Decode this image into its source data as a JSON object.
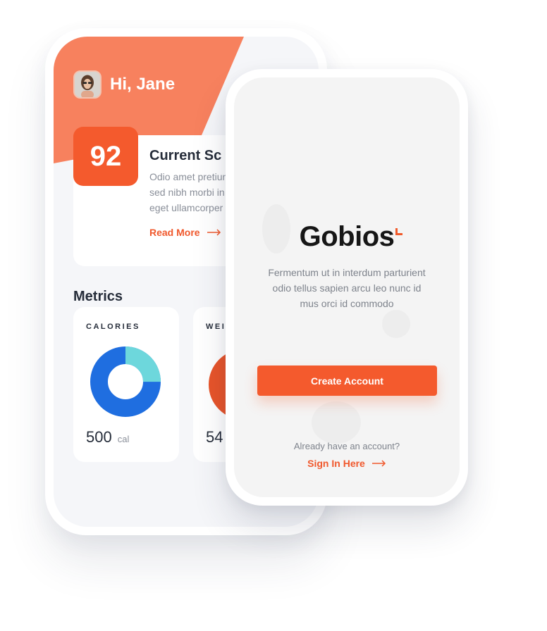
{
  "back_screen": {
    "greeting": "Hi, Jane",
    "score": {
      "value": "92",
      "title": "Current Sc",
      "description_lines": [
        "Odio amet pretiun",
        "sed nibh morbi in",
        "eget ullamcorper"
      ],
      "read_more": "Read More"
    },
    "metrics": {
      "title": "Metrics",
      "cards": [
        {
          "label": "CALORIES",
          "value": "500",
          "unit": "cal",
          "donut": {
            "blue_fraction": 0.75,
            "teal_fraction": 0.25
          }
        },
        {
          "label": "WEI",
          "value": "54"
        }
      ]
    }
  },
  "front_screen": {
    "logo": "Gobios",
    "description_lines": [
      "Fermentum ut in interdum parturient",
      "odio tellus sapien arcu leo nunc id",
      "mus orci id commodo"
    ],
    "create_account": "Create Account",
    "already_text": "Already have an account?",
    "sign_in": "Sign In Here"
  },
  "colors": {
    "accent": "#f45a2d",
    "header": "#f7815e",
    "donut_blue": "#1f6ee0",
    "donut_teal": "#6dd7dc"
  }
}
